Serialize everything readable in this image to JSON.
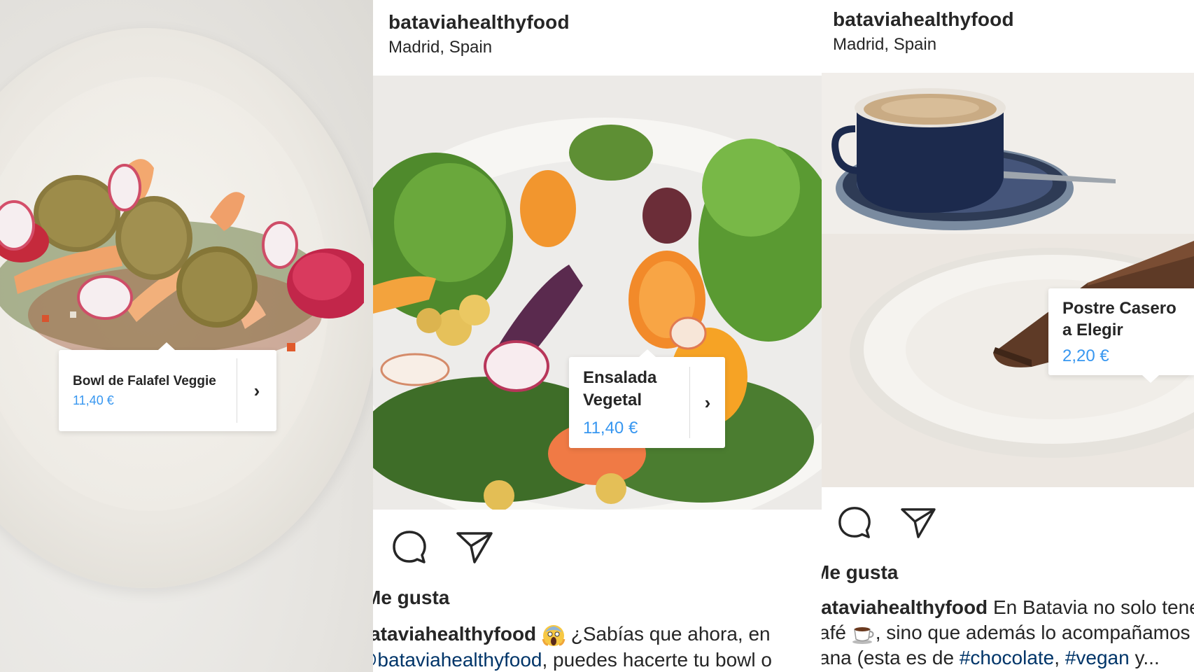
{
  "panels": [
    {
      "product_tag": {
        "name": "Bowl de Falafel Veggie",
        "price": "11,40 €",
        "arrow": "›"
      }
    },
    {
      "header": {
        "username": "bataviahealthyfood",
        "location": "Madrid, Spain"
      },
      "product_tag": {
        "name_line1": "Ensalada",
        "name_line2": "Vegetal",
        "price": "11,40 €",
        "arrow": "›"
      },
      "likes_text": "Me gusta",
      "caption": {
        "username": "bataviahealthyfood",
        "emoji": "scream-emoji",
        "text_line1": " ¿Sabías que ahora, en",
        "mention": "@bataviahealthyfood",
        "text_line2": ", puedes hacerte tu bowl o"
      }
    },
    {
      "header": {
        "username": "bataviahealthyfood",
        "location": "Madrid, Spain"
      },
      "product_tag": {
        "name_line1": "Postre Casero",
        "name_line2": "a Elegir",
        "price": "2,20 €"
      },
      "likes_text": "Me gusta",
      "caption": {
        "username": "bataviahealthyfood",
        "text_line1": " En Batavia no solo tenemos",
        "line2_start": "café",
        "emoji": "coffee-emoji",
        "text_line2": ", sino que además lo acompañamos",
        "line3_start": "sana (esta es de ",
        "hashtag1": "#chocolate",
        "sep": ", ",
        "hashtag2": "#vegan",
        "line3_end": " y..."
      }
    }
  ],
  "icons": [
    "comment-icon",
    "share-icon"
  ],
  "colors": {
    "price": "#3897f0",
    "hashtag": "#003569",
    "text": "#262626"
  }
}
